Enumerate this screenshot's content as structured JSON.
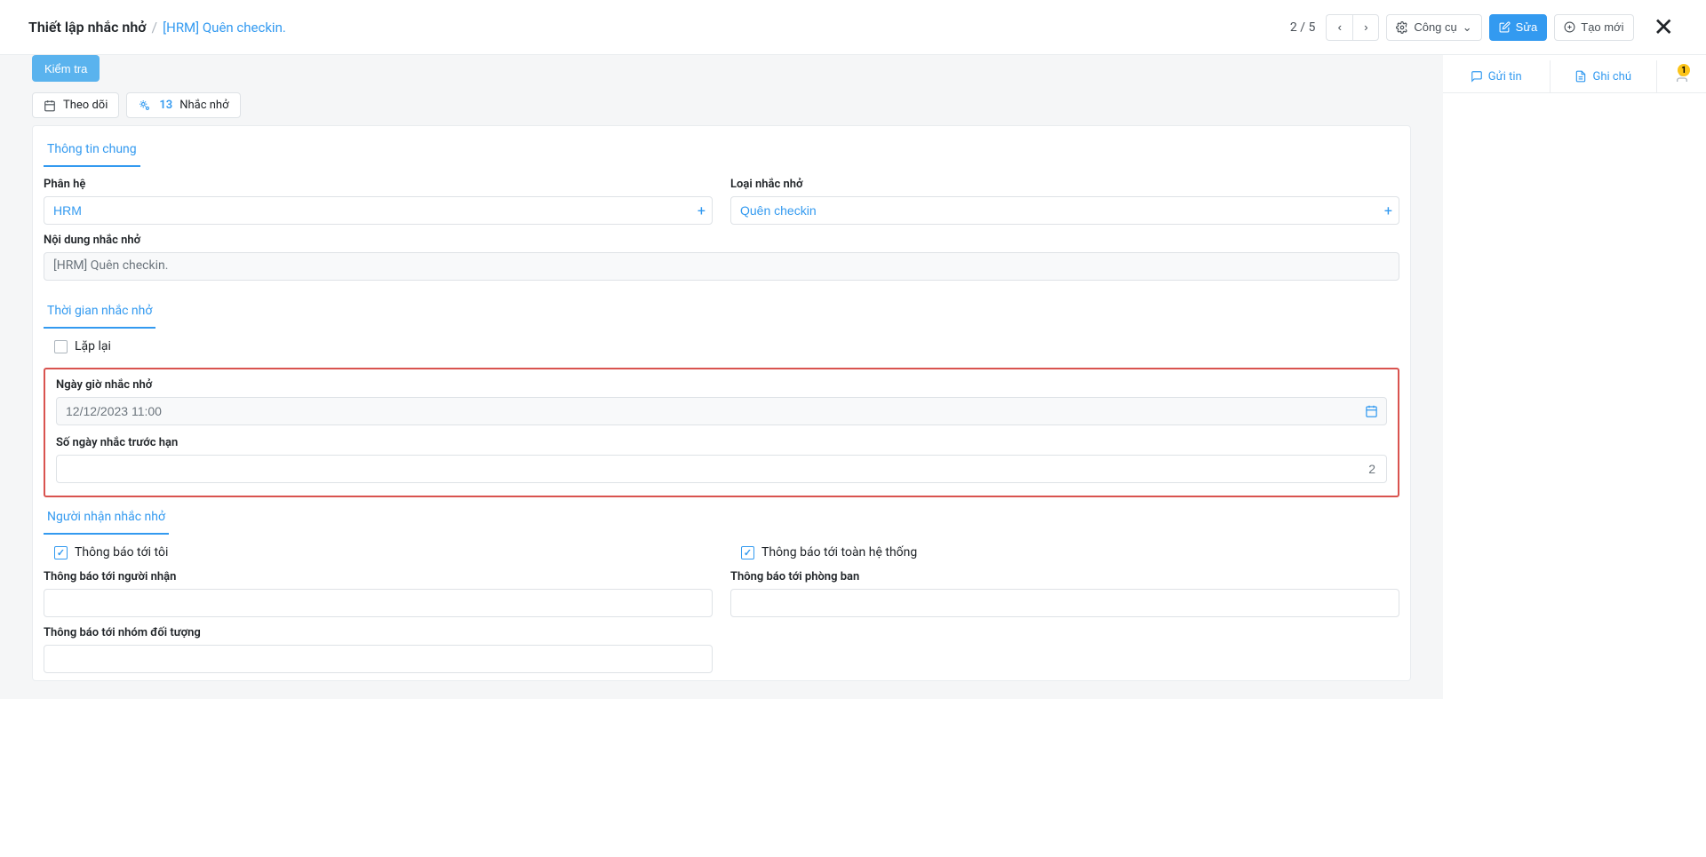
{
  "header": {
    "title": "Thiết lập nhắc nhở",
    "separator": "/",
    "subtitle": "[HRM] Quên checkin.",
    "pager": "2 / 5",
    "tools_label": "Công cụ",
    "edit_label": "Sửa",
    "create_label": "Tạo mới"
  },
  "side": {
    "send_label": "Gửi tin",
    "note_label": "Ghi chú",
    "badge": "1"
  },
  "toolbar": {
    "check_label": "Kiểm tra",
    "follow_label": "Theo dõi",
    "reminders_count": "13",
    "reminders_label": "Nhắc nhở"
  },
  "tabs": {
    "general": "Thông tin chung",
    "time": "Thời gian nhắc nhở",
    "recipients": "Người nhận nhắc nhở"
  },
  "fields": {
    "subsystem_label": "Phân hệ",
    "subsystem_value": "HRM",
    "reminder_type_label": "Loại nhắc nhở",
    "reminder_type_value": "Quên checkin",
    "content_label": "Nội dung nhắc nhở",
    "content_value": "[HRM] Quên checkin.",
    "repeat_label": "Lặp lại",
    "datetime_label": "Ngày giờ nhắc nhở",
    "datetime_value": "12/12/2023 11:00",
    "days_before_label": "Số ngày nhắc trước hạn",
    "days_before_value": "2",
    "notify_me_label": "Thông báo tới tôi",
    "notify_all_label": "Thông báo tới toàn hệ thống",
    "notify_recipients_label": "Thông báo tới người nhận",
    "notify_department_label": "Thông báo tới phòng ban",
    "notify_group_label": "Thông báo tới nhóm đối tượng"
  }
}
